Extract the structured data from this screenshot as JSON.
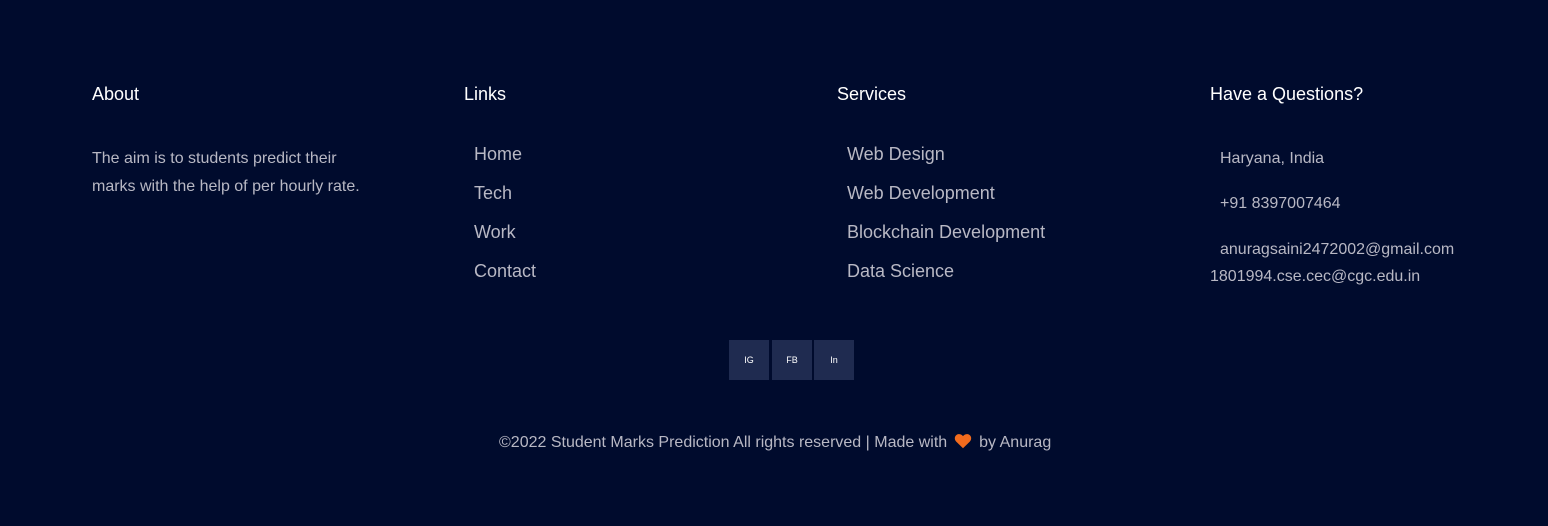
{
  "about": {
    "heading": "About",
    "text": "The aim is to students predict their marks with the help of per hourly rate."
  },
  "links": {
    "heading": "Links",
    "items": [
      "Home",
      "Tech",
      "Work",
      "Contact"
    ]
  },
  "services": {
    "heading": "Services",
    "items": [
      "Web Design",
      "Web Development",
      "Blockchain Development",
      "Data Science"
    ]
  },
  "contact": {
    "heading": "Have a Questions?",
    "address": "Haryana, India",
    "phone": "+91 8397007464",
    "email_primary": "anuragsaini2472002@gmail.com",
    "email_secondary": "1801994.cse.cec@cgc.edu.in"
  },
  "social": {
    "instagram": "IG",
    "facebook": "FB",
    "linkedin": "In"
  },
  "footer": {
    "copyright": "©2022 Student Marks Prediction All rights reserved | Made with",
    "byline": "by Anurag",
    "heart_icon": "heart-icon"
  },
  "colors": {
    "background": "#000b2d",
    "social_bg": "#1f2b50",
    "heart": "#f26b1d"
  }
}
